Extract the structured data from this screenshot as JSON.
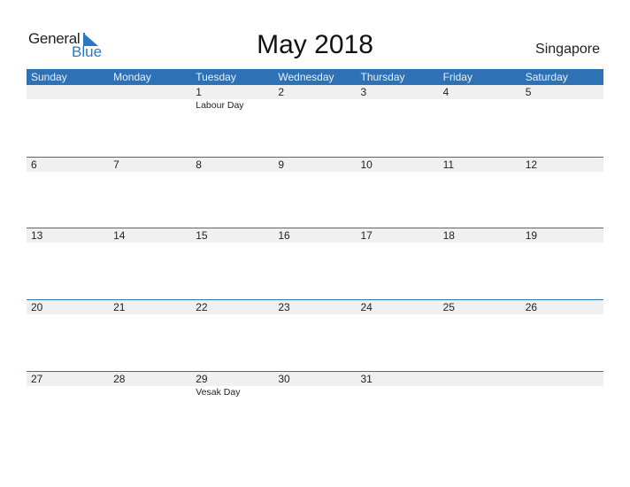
{
  "logo": {
    "general": "General",
    "blue": "Blue"
  },
  "title": "May 2018",
  "country": "Singapore",
  "colors": {
    "accent": "#2e72b5",
    "logo_blue": "#2a78c4",
    "strip_bg": "#f0f0f0"
  },
  "weekdays": [
    "Sunday",
    "Monday",
    "Tuesday",
    "Wednesday",
    "Thursday",
    "Friday",
    "Saturday"
  ],
  "weeks": [
    {
      "days": [
        "",
        "",
        "1",
        "2",
        "3",
        "4",
        "5"
      ],
      "events": [
        "",
        "",
        "Labour Day",
        "",
        "",
        "",
        ""
      ]
    },
    {
      "days": [
        "6",
        "7",
        "8",
        "9",
        "10",
        "11",
        "12"
      ],
      "events": [
        "",
        "",
        "",
        "",
        "",
        "",
        ""
      ]
    },
    {
      "days": [
        "13",
        "14",
        "15",
        "16",
        "17",
        "18",
        "19"
      ],
      "events": [
        "",
        "",
        "",
        "",
        "",
        "",
        ""
      ]
    },
    {
      "days": [
        "20",
        "21",
        "22",
        "23",
        "24",
        "25",
        "26"
      ],
      "events": [
        "",
        "",
        "",
        "",
        "",
        "",
        ""
      ]
    },
    {
      "days": [
        "27",
        "28",
        "29",
        "30",
        "31",
        "",
        ""
      ],
      "events": [
        "",
        "",
        "Vesak Day",
        "",
        "",
        "",
        ""
      ]
    }
  ]
}
